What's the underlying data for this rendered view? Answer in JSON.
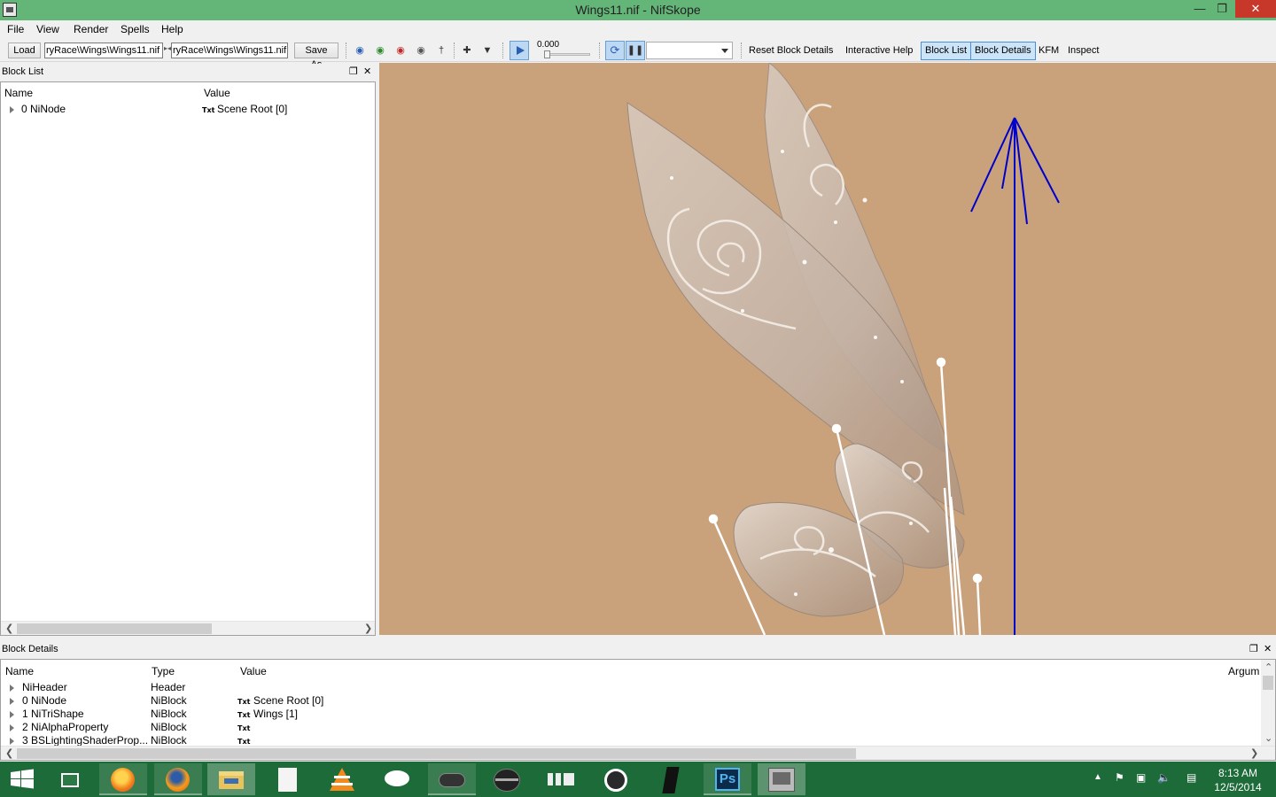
{
  "window": {
    "title": "Wings11.nif - NifSkope"
  },
  "menu": [
    "File",
    "View",
    "Render",
    "Spells",
    "Help"
  ],
  "toolbar": {
    "load_label": "Load",
    "load_path": "ryRace\\Wings\\Wings11.nif",
    "save_path": "ryRace\\Wings\\Wings11.nif",
    "save_as_label": "Save As",
    "time_value": "0.000",
    "reset_label": "Reset Block Details",
    "help_label": "Interactive Help",
    "blocklist_label": "Block List",
    "blockdetails_label": "Block Details",
    "kfm_label": "KFM",
    "inspect_label": "Inspect"
  },
  "block_list": {
    "title": "Block List",
    "columns": [
      "Name",
      "Value"
    ],
    "rows": [
      {
        "name": "0 NiNode",
        "txt": "Txt",
        "value": "Scene Root [0]"
      }
    ]
  },
  "block_details": {
    "title": "Block Details",
    "columns": [
      "Name",
      "Type",
      "Value",
      "Argum"
    ],
    "rows": [
      {
        "name": "NiHeader",
        "type": "Header",
        "txt": "",
        "value": ""
      },
      {
        "name": "0 NiNode",
        "type": "NiBlock",
        "txt": "Txt",
        "value": "Scene Root [0]"
      },
      {
        "name": "1 NiTriShape",
        "type": "NiBlock",
        "txt": "Txt",
        "value": "Wings [1]"
      },
      {
        "name": "2 NiAlphaProperty",
        "type": "NiBlock",
        "txt": "Txt",
        "value": ""
      },
      {
        "name": "3 BSLightingShaderProp...",
        "type": "NiBlock",
        "txt": "Txt",
        "value": ""
      }
    ]
  },
  "viewport": {
    "background": "#c9a27c",
    "axis_color": "#0000cc"
  },
  "taskbar": {
    "clock_time": "8:13 AM",
    "clock_date": "12/5/2014"
  }
}
